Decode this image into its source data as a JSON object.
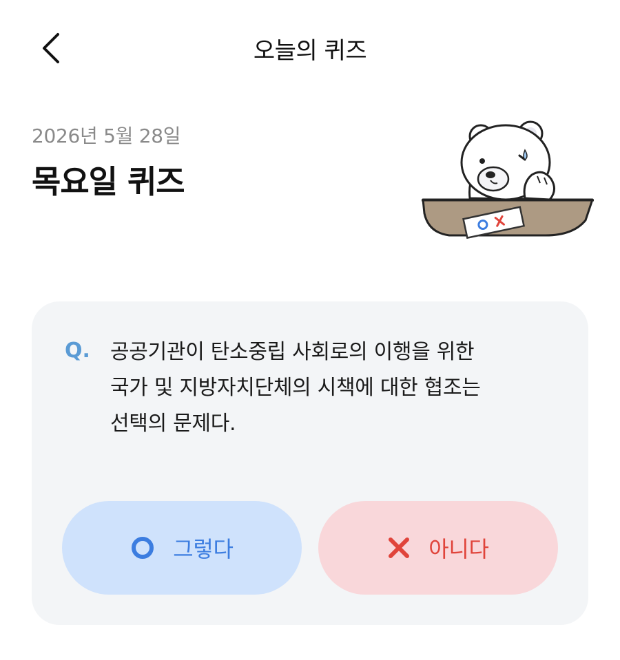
{
  "header": {
    "title": "오늘의 퀴즈",
    "back_icon": "chevron-left-icon"
  },
  "quiz": {
    "date": "2026년 5월 28일",
    "title": "목요일 퀴즈",
    "mascot": "bear-mascot-ox-quiz"
  },
  "question": {
    "prefix": "Q.",
    "text": "공공기관이 탄소중립 사회로의 이행을 위한\n국가 및 지방자치단체의 시책에 대한 협조는\n선택의 문제다."
  },
  "answers": {
    "yes": {
      "label": "그렇다",
      "icon": "circle-o-icon",
      "color": "#3c7de0",
      "background": "#cfe2fc"
    },
    "no": {
      "label": "아니다",
      "icon": "x-mark-icon",
      "color": "#e0443b",
      "background": "#f9d7da"
    }
  },
  "colors": {
    "card_background": "#f3f5f7",
    "question_prefix": "#5a9bd5",
    "date_text": "#8a8a8a"
  }
}
